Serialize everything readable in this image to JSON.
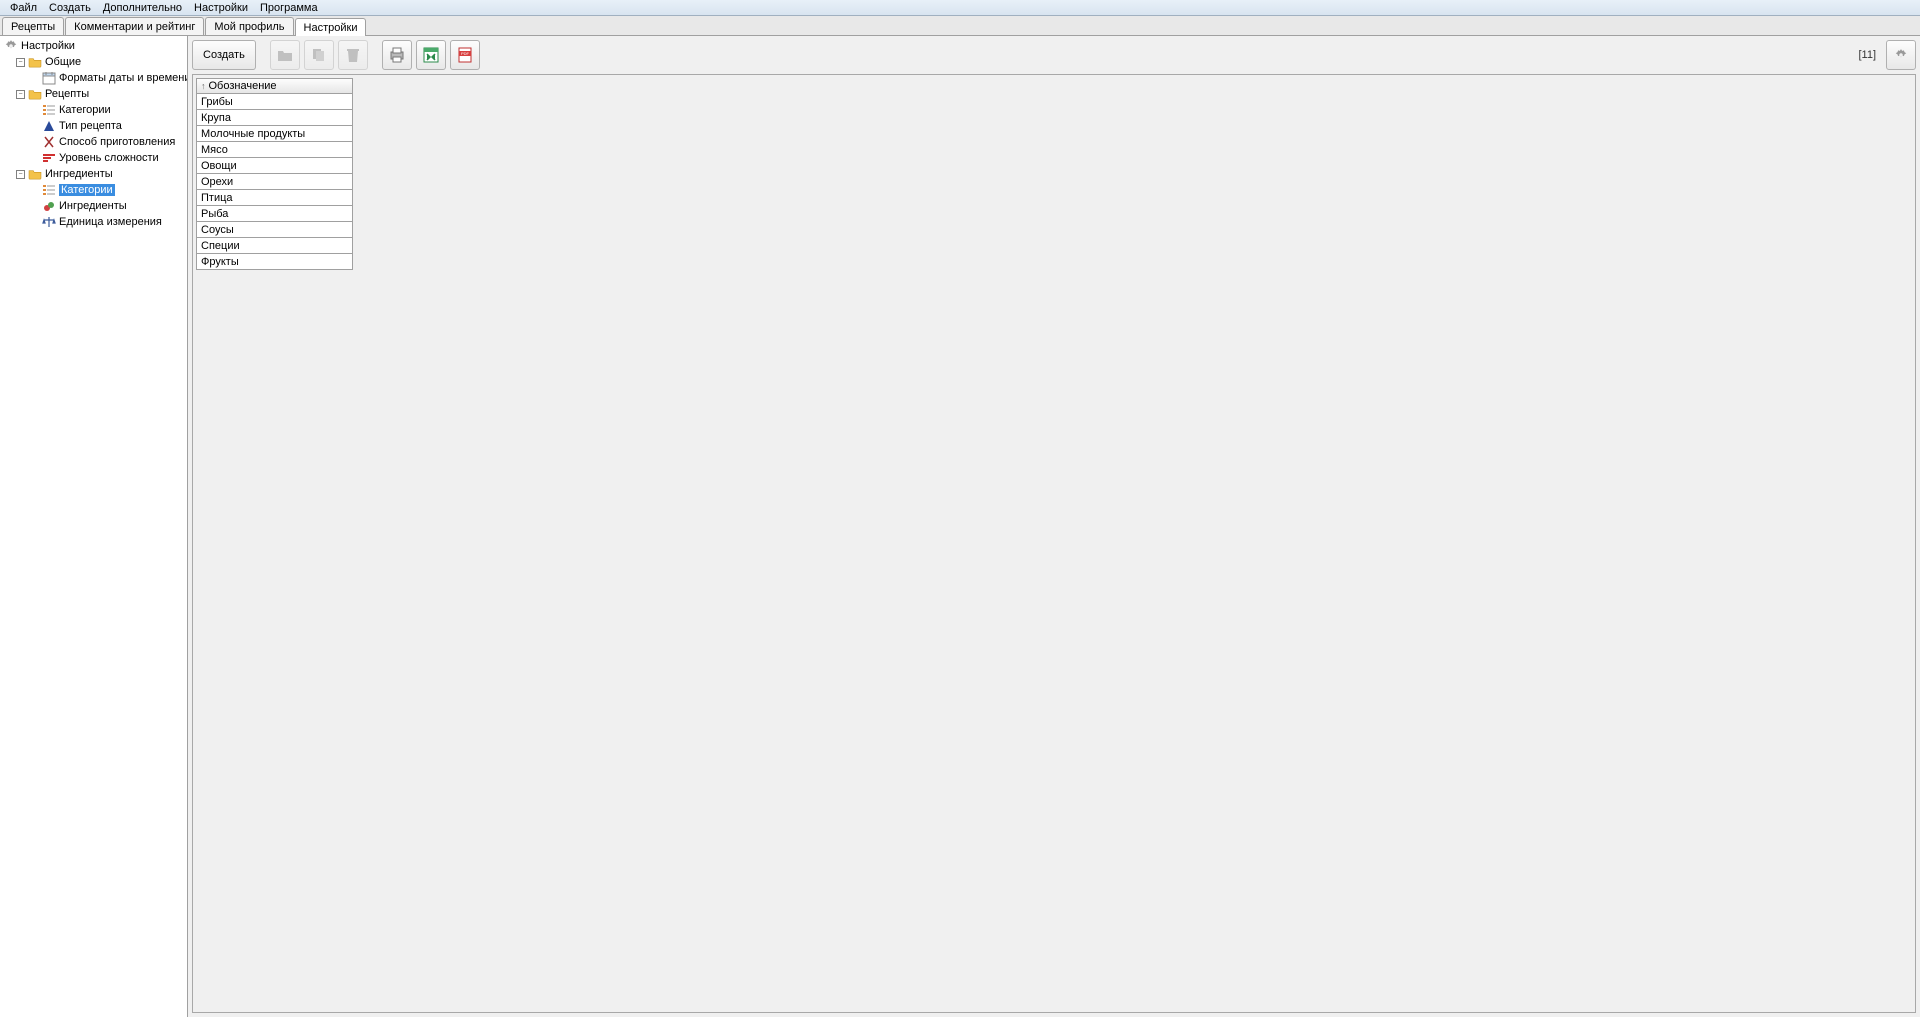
{
  "menu": {
    "file": "Файл",
    "create": "Создать",
    "additional": "Дополнительно",
    "settings": "Настройки",
    "program": "Программа"
  },
  "tabs": {
    "recipes": "Рецепты",
    "comments": "Комментарии и рейтинг",
    "profile": "Мой профиль",
    "settings": "Настройки"
  },
  "tree": {
    "root": "Настройки",
    "general": "Общие",
    "general_date": "Форматы даты и времени",
    "recipes": "Рецепты",
    "recipes_categories": "Категории",
    "recipes_type": "Тип рецепта",
    "recipes_method": "Способ приготовления",
    "recipes_level": "Уровень сложности",
    "ingredients": "Ингредиенты",
    "ingredients_categories": "Категории",
    "ingredients_list": "Ингредиенты",
    "ingredients_unit": "Единица измерения"
  },
  "toolbar": {
    "create": "Создать",
    "count": "[11]"
  },
  "table": {
    "header": "Обозначение",
    "rows": [
      "Грибы",
      "Крупа",
      "Молочные продукты",
      "Мясо",
      "Овощи",
      "Орехи",
      "Птица",
      "Рыба",
      "Соусы",
      "Специи",
      "Фрукты"
    ]
  }
}
